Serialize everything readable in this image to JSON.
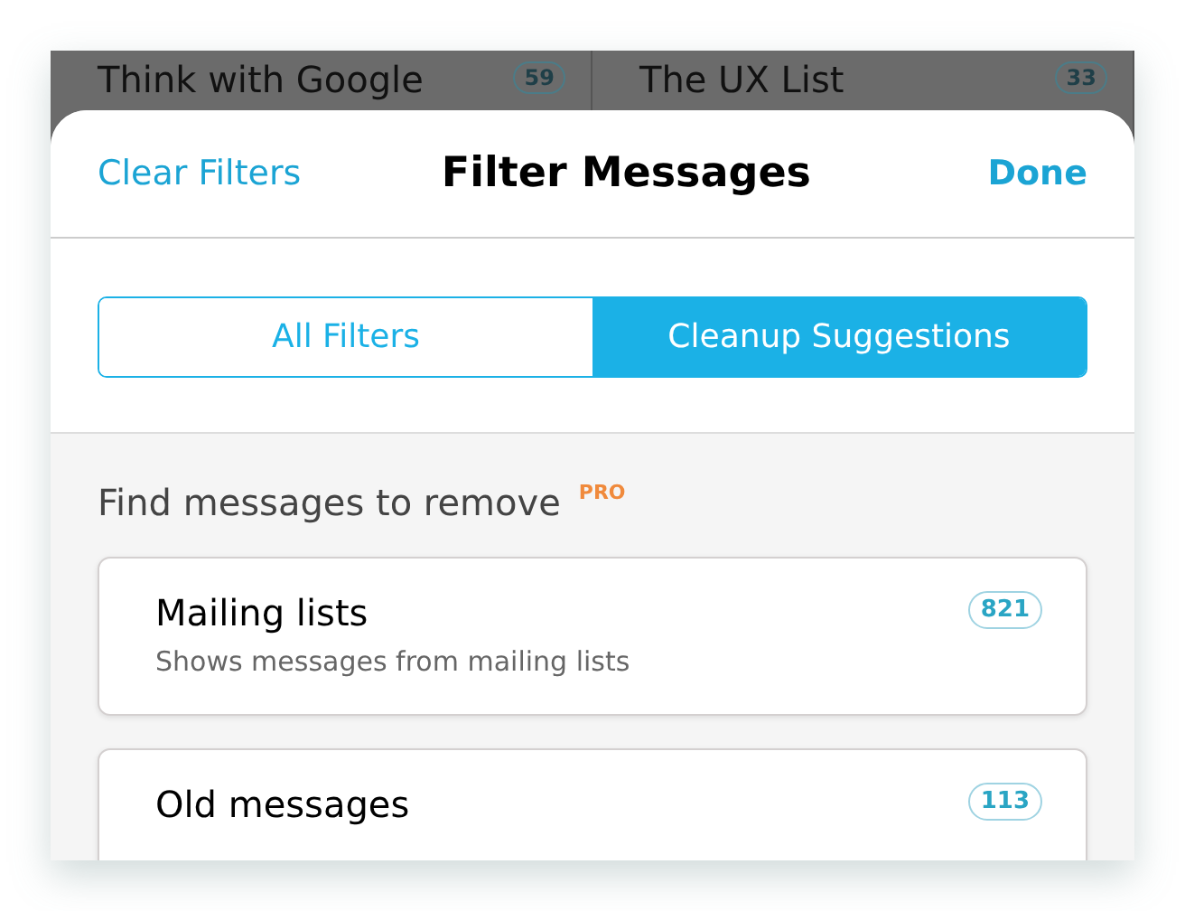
{
  "background_list": [
    {
      "name": "Think with Google",
      "count": "59"
    },
    {
      "name": "The UX List",
      "count": "33"
    }
  ],
  "sheet": {
    "left_button": "Clear Filters",
    "title": "Filter Messages",
    "right_button": "Done"
  },
  "tabs": [
    {
      "label": "All Filters",
      "selected": false
    },
    {
      "label": "Cleanup Suggestions",
      "selected": true
    }
  ],
  "section": {
    "heading": "Find messages to remove",
    "badge": "PRO"
  },
  "cards": [
    {
      "title": "Mailing lists",
      "subtitle": "Shows messages from mailing lists",
      "count": "821"
    },
    {
      "title": "Old messages",
      "count": "113"
    }
  ]
}
